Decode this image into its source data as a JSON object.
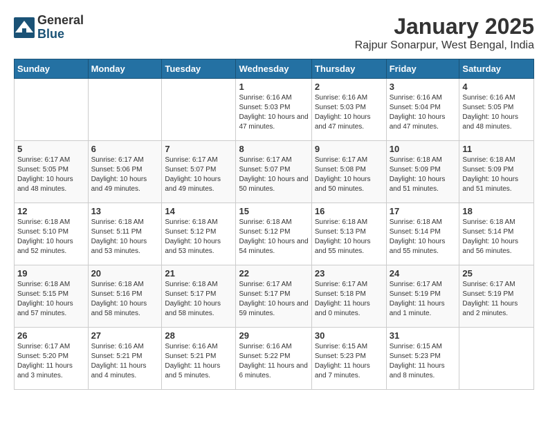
{
  "logo": {
    "general": "General",
    "blue": "Blue"
  },
  "title": "January 2025",
  "subtitle": "Rajpur Sonarpur, West Bengal, India",
  "headers": [
    "Sunday",
    "Monday",
    "Tuesday",
    "Wednesday",
    "Thursday",
    "Friday",
    "Saturday"
  ],
  "weeks": [
    [
      {
        "day": "",
        "sunrise": "",
        "sunset": "",
        "daylight": ""
      },
      {
        "day": "",
        "sunrise": "",
        "sunset": "",
        "daylight": ""
      },
      {
        "day": "",
        "sunrise": "",
        "sunset": "",
        "daylight": ""
      },
      {
        "day": "1",
        "sunrise": "Sunrise: 6:16 AM",
        "sunset": "Sunset: 5:03 PM",
        "daylight": "Daylight: 10 hours and 47 minutes."
      },
      {
        "day": "2",
        "sunrise": "Sunrise: 6:16 AM",
        "sunset": "Sunset: 5:03 PM",
        "daylight": "Daylight: 10 hours and 47 minutes."
      },
      {
        "day": "3",
        "sunrise": "Sunrise: 6:16 AM",
        "sunset": "Sunset: 5:04 PM",
        "daylight": "Daylight: 10 hours and 47 minutes."
      },
      {
        "day": "4",
        "sunrise": "Sunrise: 6:16 AM",
        "sunset": "Sunset: 5:05 PM",
        "daylight": "Daylight: 10 hours and 48 minutes."
      }
    ],
    [
      {
        "day": "5",
        "sunrise": "Sunrise: 6:17 AM",
        "sunset": "Sunset: 5:05 PM",
        "daylight": "Daylight: 10 hours and 48 minutes."
      },
      {
        "day": "6",
        "sunrise": "Sunrise: 6:17 AM",
        "sunset": "Sunset: 5:06 PM",
        "daylight": "Daylight: 10 hours and 49 minutes."
      },
      {
        "day": "7",
        "sunrise": "Sunrise: 6:17 AM",
        "sunset": "Sunset: 5:07 PM",
        "daylight": "Daylight: 10 hours and 49 minutes."
      },
      {
        "day": "8",
        "sunrise": "Sunrise: 6:17 AM",
        "sunset": "Sunset: 5:07 PM",
        "daylight": "Daylight: 10 hours and 50 minutes."
      },
      {
        "day": "9",
        "sunrise": "Sunrise: 6:17 AM",
        "sunset": "Sunset: 5:08 PM",
        "daylight": "Daylight: 10 hours and 50 minutes."
      },
      {
        "day": "10",
        "sunrise": "Sunrise: 6:18 AM",
        "sunset": "Sunset: 5:09 PM",
        "daylight": "Daylight: 10 hours and 51 minutes."
      },
      {
        "day": "11",
        "sunrise": "Sunrise: 6:18 AM",
        "sunset": "Sunset: 5:09 PM",
        "daylight": "Daylight: 10 hours and 51 minutes."
      }
    ],
    [
      {
        "day": "12",
        "sunrise": "Sunrise: 6:18 AM",
        "sunset": "Sunset: 5:10 PM",
        "daylight": "Daylight: 10 hours and 52 minutes."
      },
      {
        "day": "13",
        "sunrise": "Sunrise: 6:18 AM",
        "sunset": "Sunset: 5:11 PM",
        "daylight": "Daylight: 10 hours and 53 minutes."
      },
      {
        "day": "14",
        "sunrise": "Sunrise: 6:18 AM",
        "sunset": "Sunset: 5:12 PM",
        "daylight": "Daylight: 10 hours and 53 minutes."
      },
      {
        "day": "15",
        "sunrise": "Sunrise: 6:18 AM",
        "sunset": "Sunset: 5:12 PM",
        "daylight": "Daylight: 10 hours and 54 minutes."
      },
      {
        "day": "16",
        "sunrise": "Sunrise: 6:18 AM",
        "sunset": "Sunset: 5:13 PM",
        "daylight": "Daylight: 10 hours and 55 minutes."
      },
      {
        "day": "17",
        "sunrise": "Sunrise: 6:18 AM",
        "sunset": "Sunset: 5:14 PM",
        "daylight": "Daylight: 10 hours and 55 minutes."
      },
      {
        "day": "18",
        "sunrise": "Sunrise: 6:18 AM",
        "sunset": "Sunset: 5:14 PM",
        "daylight": "Daylight: 10 hours and 56 minutes."
      }
    ],
    [
      {
        "day": "19",
        "sunrise": "Sunrise: 6:18 AM",
        "sunset": "Sunset: 5:15 PM",
        "daylight": "Daylight: 10 hours and 57 minutes."
      },
      {
        "day": "20",
        "sunrise": "Sunrise: 6:18 AM",
        "sunset": "Sunset: 5:16 PM",
        "daylight": "Daylight: 10 hours and 58 minutes."
      },
      {
        "day": "21",
        "sunrise": "Sunrise: 6:18 AM",
        "sunset": "Sunset: 5:17 PM",
        "daylight": "Daylight: 10 hours and 58 minutes."
      },
      {
        "day": "22",
        "sunrise": "Sunrise: 6:17 AM",
        "sunset": "Sunset: 5:17 PM",
        "daylight": "Daylight: 10 hours and 59 minutes."
      },
      {
        "day": "23",
        "sunrise": "Sunrise: 6:17 AM",
        "sunset": "Sunset: 5:18 PM",
        "daylight": "Daylight: 11 hours and 0 minutes."
      },
      {
        "day": "24",
        "sunrise": "Sunrise: 6:17 AM",
        "sunset": "Sunset: 5:19 PM",
        "daylight": "Daylight: 11 hours and 1 minute."
      },
      {
        "day": "25",
        "sunrise": "Sunrise: 6:17 AM",
        "sunset": "Sunset: 5:19 PM",
        "daylight": "Daylight: 11 hours and 2 minutes."
      }
    ],
    [
      {
        "day": "26",
        "sunrise": "Sunrise: 6:17 AM",
        "sunset": "Sunset: 5:20 PM",
        "daylight": "Daylight: 11 hours and 3 minutes."
      },
      {
        "day": "27",
        "sunrise": "Sunrise: 6:16 AM",
        "sunset": "Sunset: 5:21 PM",
        "daylight": "Daylight: 11 hours and 4 minutes."
      },
      {
        "day": "28",
        "sunrise": "Sunrise: 6:16 AM",
        "sunset": "Sunset: 5:21 PM",
        "daylight": "Daylight: 11 hours and 5 minutes."
      },
      {
        "day": "29",
        "sunrise": "Sunrise: 6:16 AM",
        "sunset": "Sunset: 5:22 PM",
        "daylight": "Daylight: 11 hours and 6 minutes."
      },
      {
        "day": "30",
        "sunrise": "Sunrise: 6:15 AM",
        "sunset": "Sunset: 5:23 PM",
        "daylight": "Daylight: 11 hours and 7 minutes."
      },
      {
        "day": "31",
        "sunrise": "Sunrise: 6:15 AM",
        "sunset": "Sunset: 5:23 PM",
        "daylight": "Daylight: 11 hours and 8 minutes."
      },
      {
        "day": "",
        "sunrise": "",
        "sunset": "",
        "daylight": ""
      }
    ]
  ]
}
